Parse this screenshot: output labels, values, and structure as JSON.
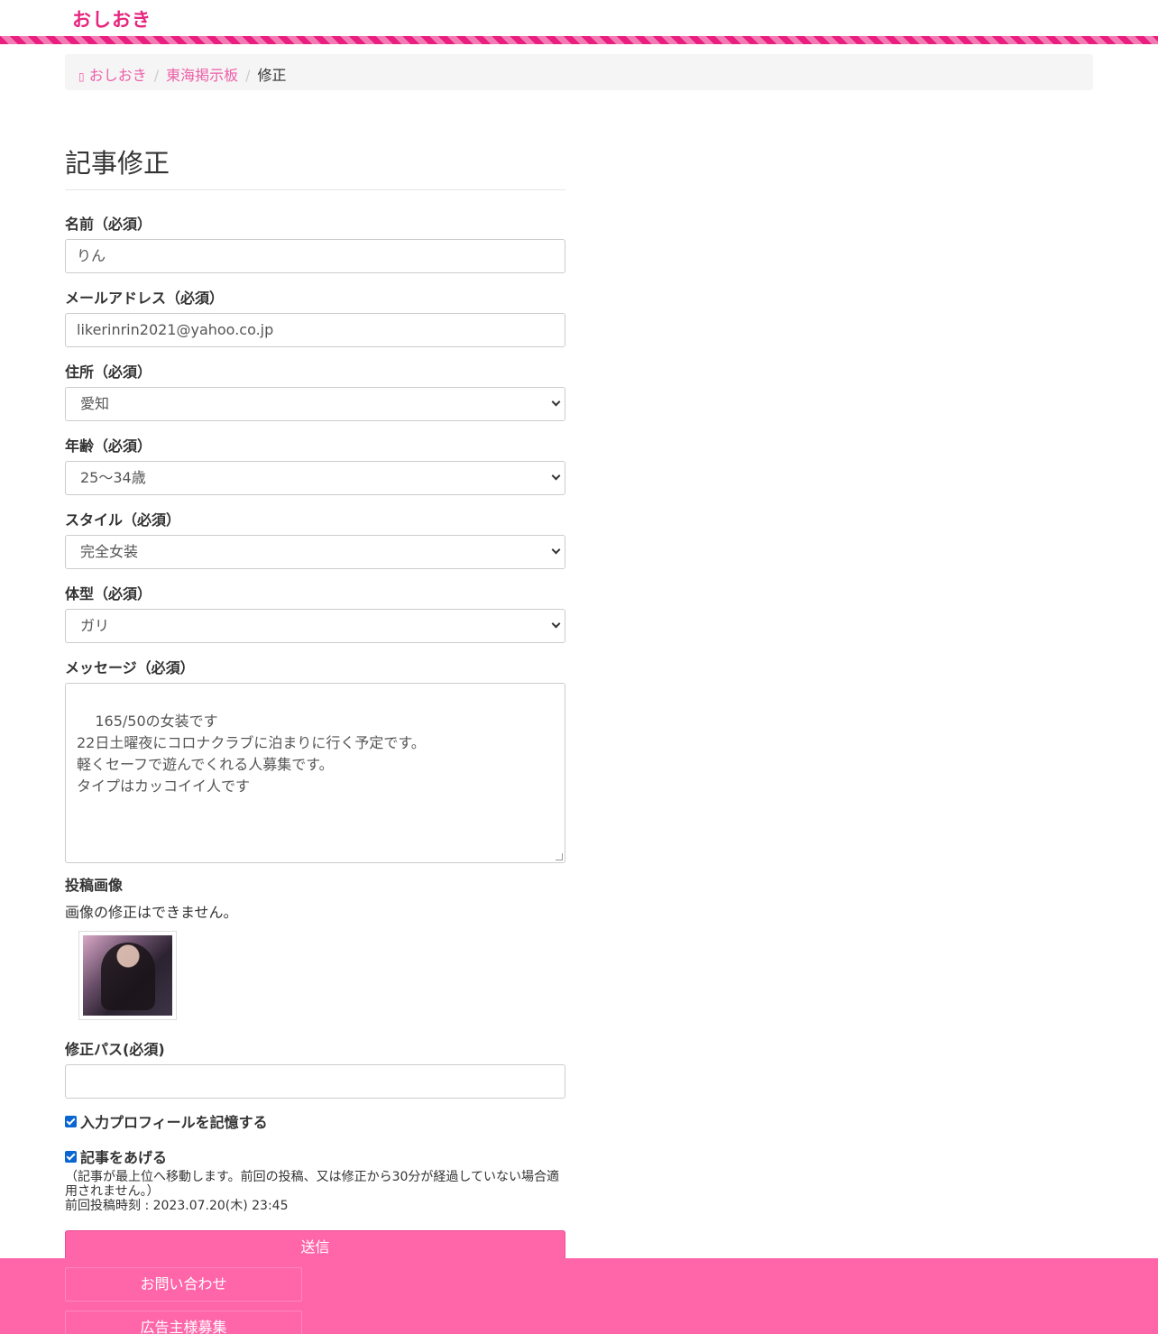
{
  "header": {
    "logo": "おしおき"
  },
  "breadcrumb": {
    "home_icon": "home-icon",
    "items": [
      {
        "label": "おしおき"
      },
      {
        "label": "東海掲示板"
      },
      {
        "label": "修正"
      }
    ]
  },
  "form": {
    "title": "記事修正",
    "name": {
      "label": "名前（必須）",
      "value": "りん"
    },
    "email": {
      "label": "メールアドレス（必須）",
      "value": "likerinrin2021@yahoo.co.jp"
    },
    "address": {
      "label": "住所（必須）",
      "value": "愛知"
    },
    "age": {
      "label": "年齢（必須）",
      "value": "25～34歳"
    },
    "style": {
      "label": "スタイル（必須）",
      "value": "完全女装"
    },
    "body_type": {
      "label": "体型（必須）",
      "value": "ガリ"
    },
    "message": {
      "label": "メッセージ（必須）",
      "value": "165/50の女装です\n22日土曜夜にコロナクラブに泊まりに行く予定です。\n軽くセーフで遊んでくれる人募集です。\nタイプはカッコイイ人です"
    },
    "image": {
      "label": "投稿画像",
      "note": "画像の修正はできません。"
    },
    "password": {
      "label": "修正パス(必須)",
      "value": ""
    },
    "remember": {
      "label": "入力プロフィールを記憶する",
      "checked": true
    },
    "bump": {
      "label": "記事をあげる",
      "checked": true,
      "note": "（記事が最上位へ移動します。前回の投稿、又は修正から30分が経過していない場合適用されません。）",
      "last_post": "前回投稿時刻 : 2023.07.20(木) 23:45"
    },
    "submit_label": "送信"
  },
  "footer": {
    "links": [
      {
        "label": "お問い合わせ"
      },
      {
        "label": "広告主様募集"
      }
    ]
  },
  "colors": {
    "accent": "#ff66aa",
    "link": "#ee5fa8",
    "logo": "#e6277f"
  }
}
